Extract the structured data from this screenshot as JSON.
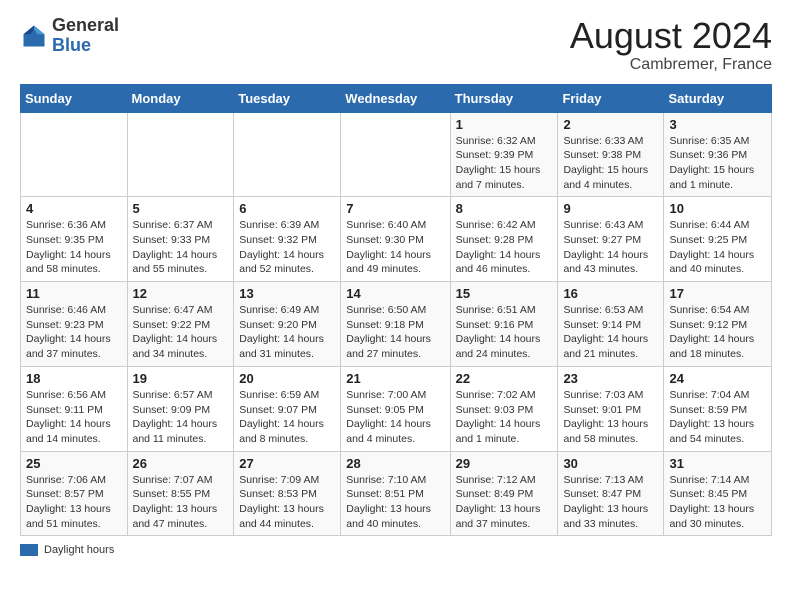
{
  "header": {
    "logo_general": "General",
    "logo_blue": "Blue",
    "month_year": "August 2024",
    "location": "Cambremer, France"
  },
  "days_of_week": [
    "Sunday",
    "Monday",
    "Tuesday",
    "Wednesday",
    "Thursday",
    "Friday",
    "Saturday"
  ],
  "legend": {
    "label": "Daylight hours"
  },
  "weeks": [
    [
      {
        "day": "",
        "info": ""
      },
      {
        "day": "",
        "info": ""
      },
      {
        "day": "",
        "info": ""
      },
      {
        "day": "",
        "info": ""
      },
      {
        "day": "1",
        "info": "Sunrise: 6:32 AM\nSunset: 9:39 PM\nDaylight: 15 hours and 7 minutes."
      },
      {
        "day": "2",
        "info": "Sunrise: 6:33 AM\nSunset: 9:38 PM\nDaylight: 15 hours and 4 minutes."
      },
      {
        "day": "3",
        "info": "Sunrise: 6:35 AM\nSunset: 9:36 PM\nDaylight: 15 hours and 1 minute."
      }
    ],
    [
      {
        "day": "4",
        "info": "Sunrise: 6:36 AM\nSunset: 9:35 PM\nDaylight: 14 hours and 58 minutes."
      },
      {
        "day": "5",
        "info": "Sunrise: 6:37 AM\nSunset: 9:33 PM\nDaylight: 14 hours and 55 minutes."
      },
      {
        "day": "6",
        "info": "Sunrise: 6:39 AM\nSunset: 9:32 PM\nDaylight: 14 hours and 52 minutes."
      },
      {
        "day": "7",
        "info": "Sunrise: 6:40 AM\nSunset: 9:30 PM\nDaylight: 14 hours and 49 minutes."
      },
      {
        "day": "8",
        "info": "Sunrise: 6:42 AM\nSunset: 9:28 PM\nDaylight: 14 hours and 46 minutes."
      },
      {
        "day": "9",
        "info": "Sunrise: 6:43 AM\nSunset: 9:27 PM\nDaylight: 14 hours and 43 minutes."
      },
      {
        "day": "10",
        "info": "Sunrise: 6:44 AM\nSunset: 9:25 PM\nDaylight: 14 hours and 40 minutes."
      }
    ],
    [
      {
        "day": "11",
        "info": "Sunrise: 6:46 AM\nSunset: 9:23 PM\nDaylight: 14 hours and 37 minutes."
      },
      {
        "day": "12",
        "info": "Sunrise: 6:47 AM\nSunset: 9:22 PM\nDaylight: 14 hours and 34 minutes."
      },
      {
        "day": "13",
        "info": "Sunrise: 6:49 AM\nSunset: 9:20 PM\nDaylight: 14 hours and 31 minutes."
      },
      {
        "day": "14",
        "info": "Sunrise: 6:50 AM\nSunset: 9:18 PM\nDaylight: 14 hours and 27 minutes."
      },
      {
        "day": "15",
        "info": "Sunrise: 6:51 AM\nSunset: 9:16 PM\nDaylight: 14 hours and 24 minutes."
      },
      {
        "day": "16",
        "info": "Sunrise: 6:53 AM\nSunset: 9:14 PM\nDaylight: 14 hours and 21 minutes."
      },
      {
        "day": "17",
        "info": "Sunrise: 6:54 AM\nSunset: 9:12 PM\nDaylight: 14 hours and 18 minutes."
      }
    ],
    [
      {
        "day": "18",
        "info": "Sunrise: 6:56 AM\nSunset: 9:11 PM\nDaylight: 14 hours and 14 minutes."
      },
      {
        "day": "19",
        "info": "Sunrise: 6:57 AM\nSunset: 9:09 PM\nDaylight: 14 hours and 11 minutes."
      },
      {
        "day": "20",
        "info": "Sunrise: 6:59 AM\nSunset: 9:07 PM\nDaylight: 14 hours and 8 minutes."
      },
      {
        "day": "21",
        "info": "Sunrise: 7:00 AM\nSunset: 9:05 PM\nDaylight: 14 hours and 4 minutes."
      },
      {
        "day": "22",
        "info": "Sunrise: 7:02 AM\nSunset: 9:03 PM\nDaylight: 14 hours and 1 minute."
      },
      {
        "day": "23",
        "info": "Sunrise: 7:03 AM\nSunset: 9:01 PM\nDaylight: 13 hours and 58 minutes."
      },
      {
        "day": "24",
        "info": "Sunrise: 7:04 AM\nSunset: 8:59 PM\nDaylight: 13 hours and 54 minutes."
      }
    ],
    [
      {
        "day": "25",
        "info": "Sunrise: 7:06 AM\nSunset: 8:57 PM\nDaylight: 13 hours and 51 minutes."
      },
      {
        "day": "26",
        "info": "Sunrise: 7:07 AM\nSunset: 8:55 PM\nDaylight: 13 hours and 47 minutes."
      },
      {
        "day": "27",
        "info": "Sunrise: 7:09 AM\nSunset: 8:53 PM\nDaylight: 13 hours and 44 minutes."
      },
      {
        "day": "28",
        "info": "Sunrise: 7:10 AM\nSunset: 8:51 PM\nDaylight: 13 hours and 40 minutes."
      },
      {
        "day": "29",
        "info": "Sunrise: 7:12 AM\nSunset: 8:49 PM\nDaylight: 13 hours and 37 minutes."
      },
      {
        "day": "30",
        "info": "Sunrise: 7:13 AM\nSunset: 8:47 PM\nDaylight: 13 hours and 33 minutes."
      },
      {
        "day": "31",
        "info": "Sunrise: 7:14 AM\nSunset: 8:45 PM\nDaylight: 13 hours and 30 minutes."
      }
    ]
  ]
}
